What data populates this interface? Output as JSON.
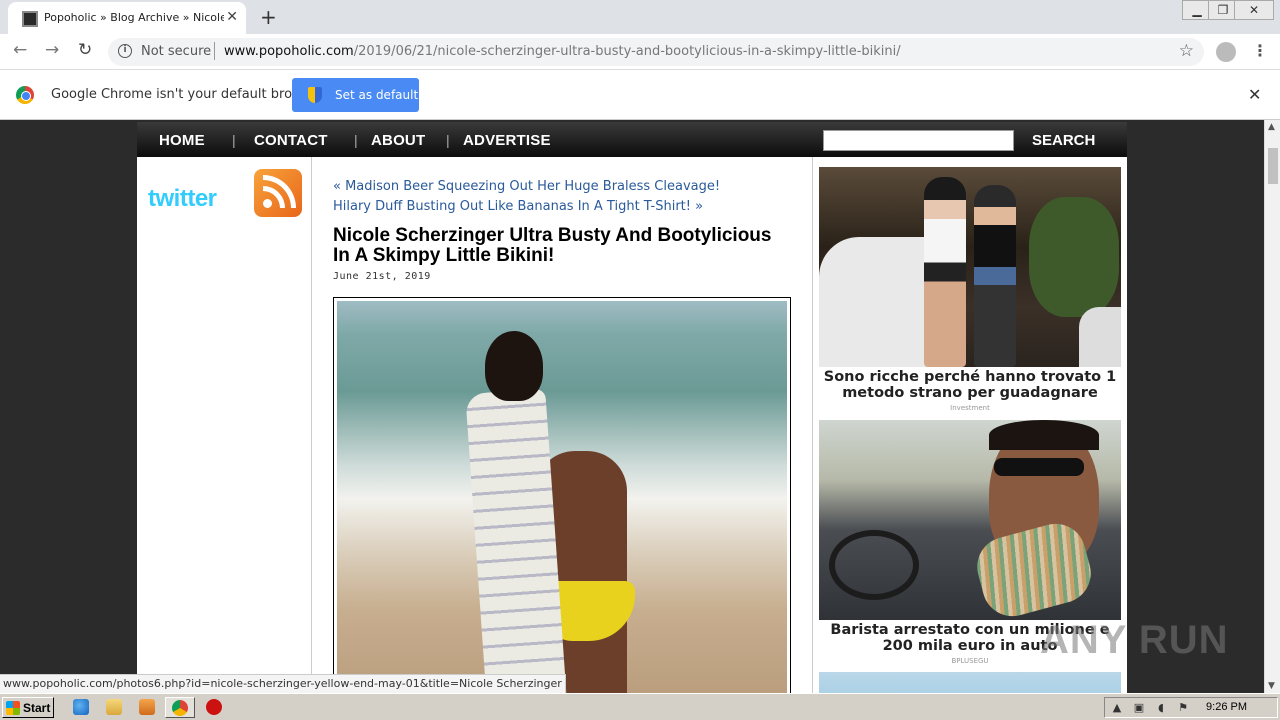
{
  "browser": {
    "tab_title": "Popoholic » Blog Archive » Nicole Sch",
    "tab_close": "✕",
    "new_tab": "+",
    "security_label": "Not secure",
    "url_domain": "www.popoholic.com",
    "url_path": "/2019/06/21/nicole-scherzinger-ultra-busty-and-bootylicious-in-a-skimpy-little-bikini/",
    "back": "←",
    "forward": "→",
    "reload": "↻",
    "star": "☆",
    "menu": "⋮",
    "window_minimize": "▁",
    "window_restore": "❐",
    "window_close": "✕"
  },
  "infobar": {
    "message": "Google Chrome isn't your default browser",
    "button_label": "Set as default",
    "close": "✕"
  },
  "site": {
    "nav": [
      {
        "label": "HOME"
      },
      {
        "label": "CONTACT"
      },
      {
        "label": "ABOUT"
      },
      {
        "label": "ADVERTISE"
      }
    ],
    "nav_sep": "|",
    "search_label": "SEARCH",
    "twitter_label": "twitter",
    "prev_link": "« Madison Beer Squeezing Out Her Huge Braless Cleavage!",
    "next_link": "Hilary Duff Busting Out Like Bananas In A Tight T-Shirt! »",
    "post_title": "Nicole Scherzinger Ultra Busty And Bootylicious In A Skimpy Little Bikini!",
    "post_date": "June 21st, 2019"
  },
  "ads": [
    {
      "caption": "Sono ricche perché hanno trovato 1 metodo strano per guadagnare",
      "source": "Investment"
    },
    {
      "caption": "Barista arrestato con un milione e 200 mila euro in auto",
      "source": "BPLUSEGU"
    }
  ],
  "status_url": "www.popoholic.com/photos6.php?id=nicole-scherzinger-yellow-end-may-01&title=Nicole Scherzinger",
  "taskbar": {
    "start_label": "Start",
    "clock": "9:26 PM"
  },
  "watermark": "ANY RUN"
}
